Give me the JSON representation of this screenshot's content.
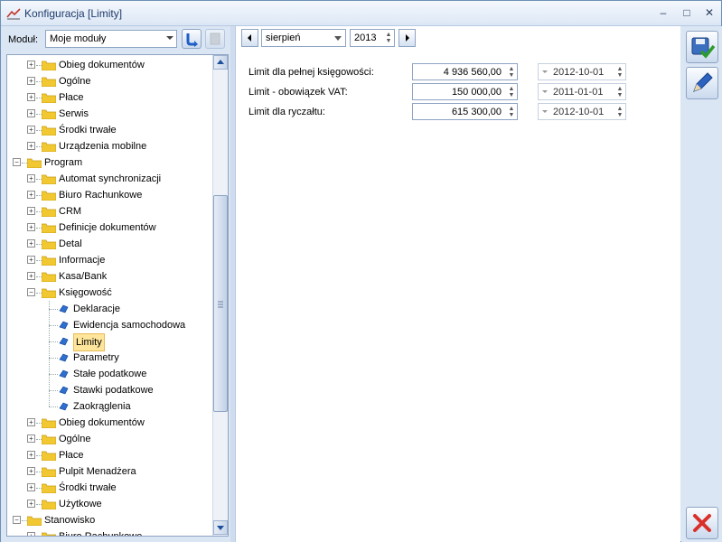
{
  "window": {
    "title": "Konfiguracja [Limity]",
    "minimize": "–",
    "maximize": "□",
    "close": "✕"
  },
  "module": {
    "label": "Moduł:",
    "value": "Moje moduły"
  },
  "tree": [
    {
      "text": "Obieg dokumentów",
      "level": 1,
      "type": "folder",
      "exp": "+"
    },
    {
      "text": "Ogólne",
      "level": 1,
      "type": "folder",
      "exp": "+"
    },
    {
      "text": "Płace",
      "level": 1,
      "type": "folder",
      "exp": "+"
    },
    {
      "text": "Serwis",
      "level": 1,
      "type": "folder",
      "exp": "+"
    },
    {
      "text": "Środki trwałe",
      "level": 1,
      "type": "folder",
      "exp": "+"
    },
    {
      "text": "Urządzenia mobilne",
      "level": 1,
      "type": "folder",
      "exp": "+"
    },
    {
      "text": "Program",
      "level": 0,
      "type": "folder",
      "exp": "-"
    },
    {
      "text": "Automat synchronizacji",
      "level": 1,
      "type": "folder",
      "exp": "+"
    },
    {
      "text": "Biuro Rachunkowe",
      "level": 1,
      "type": "folder",
      "exp": "+"
    },
    {
      "text": "CRM",
      "level": 1,
      "type": "folder",
      "exp": "+"
    },
    {
      "text": "Definicje dokumentów",
      "level": 1,
      "type": "folder",
      "exp": "+"
    },
    {
      "text": "Detal",
      "level": 1,
      "type": "folder",
      "exp": "+"
    },
    {
      "text": "Informacje",
      "level": 1,
      "type": "folder",
      "exp": "+"
    },
    {
      "text": "Kasa/Bank",
      "level": 1,
      "type": "folder",
      "exp": "+"
    },
    {
      "text": "Księgowość",
      "level": 1,
      "type": "folder",
      "exp": "-"
    },
    {
      "text": "Deklaracje",
      "level": 2,
      "type": "leaf"
    },
    {
      "text": "Ewidencja samochodowa",
      "level": 2,
      "type": "leaf"
    },
    {
      "text": "Limity",
      "level": 2,
      "type": "leaf",
      "selected": true
    },
    {
      "text": "Parametry",
      "level": 2,
      "type": "leaf"
    },
    {
      "text": "Stałe podatkowe",
      "level": 2,
      "type": "leaf"
    },
    {
      "text": "Stawki podatkowe",
      "level": 2,
      "type": "leaf"
    },
    {
      "text": "Zaokrąglenia",
      "level": 2,
      "type": "leaf"
    },
    {
      "text": "Obieg dokumentów",
      "level": 1,
      "type": "folder",
      "exp": "+"
    },
    {
      "text": "Ogólne",
      "level": 1,
      "type": "folder",
      "exp": "+"
    },
    {
      "text": "Płace",
      "level": 1,
      "type": "folder",
      "exp": "+"
    },
    {
      "text": "Pulpit Menadżera",
      "level": 1,
      "type": "folder",
      "exp": "+"
    },
    {
      "text": "Środki trwałe",
      "level": 1,
      "type": "folder",
      "exp": "+"
    },
    {
      "text": "Użytkowe",
      "level": 1,
      "type": "folder",
      "exp": "+"
    },
    {
      "text": "Stanowisko",
      "level": 0,
      "type": "folder",
      "exp": "-"
    },
    {
      "text": "Biuro Rachunkowe",
      "level": 1,
      "type": "folder",
      "exp": "+"
    }
  ],
  "period": {
    "month": "sierpień",
    "year": "2013"
  },
  "limits": [
    {
      "label": "Limit dla pełnej księgowości:",
      "value": "4 936 560,00",
      "date": "2012-10-01"
    },
    {
      "label": "Limit - obowiązek VAT:",
      "value": "150 000,00",
      "date": "2011-01-01"
    },
    {
      "label": "Limit dla ryczałtu:",
      "value": "615 300,00",
      "date": "2012-10-01"
    }
  ],
  "colors": {
    "accent": "#2e6fd0",
    "selection": "#fde59b",
    "folder": "#f2c832",
    "close_red": "#d9302a"
  }
}
